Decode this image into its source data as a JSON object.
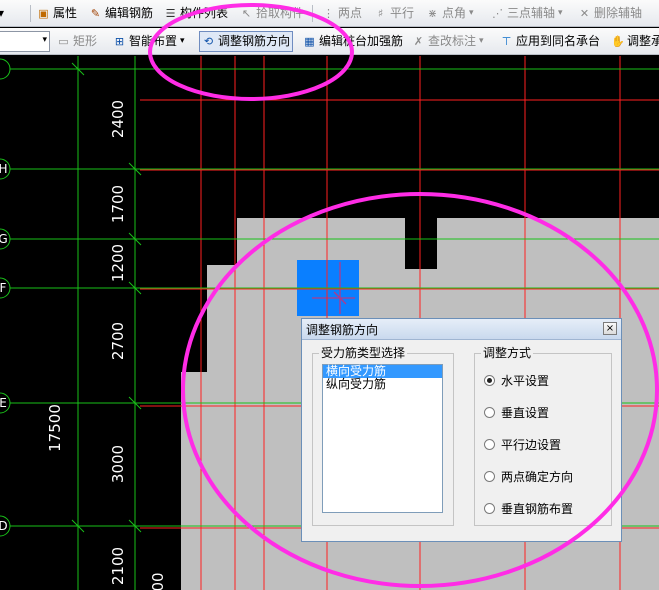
{
  "toolbar_top": {
    "items": [
      {
        "label": "属性",
        "icon": "properties-icon"
      },
      {
        "label": "编辑钢筋",
        "icon": "edit-rebar-icon"
      },
      {
        "label": "构件列表",
        "icon": "component-list-icon"
      },
      {
        "label": "拾取构件",
        "icon": "pick-component-icon"
      },
      {
        "label": "两点",
        "icon": "two-point-icon"
      },
      {
        "label": "平行",
        "icon": "parallel-icon"
      },
      {
        "label": "点角",
        "icon": "point-angle-icon"
      },
      {
        "label": "三点辅轴",
        "icon": "three-point-axis-icon"
      },
      {
        "label": "删除辅轴",
        "icon": "delete-axis-icon"
      }
    ]
  },
  "toolbar_second": {
    "items": [
      {
        "label": "矩形",
        "icon": "rectangle-icon"
      },
      {
        "label": "智能布置",
        "icon": "smart-layout-icon"
      },
      {
        "label": "调整钢筋方向",
        "icon": "adjust-rebar-direction-icon"
      },
      {
        "label": "编辑桩台加强筋",
        "icon": "edit-pile-cap-rebar-icon"
      },
      {
        "label": "查改标注",
        "icon": "check-annotation-icon"
      },
      {
        "label": "应用到同名承台",
        "icon": "apply-same-cap-icon"
      },
      {
        "label": "调整承",
        "icon": "adjust-cap-icon"
      }
    ]
  },
  "canvas": {
    "axis_labels": [
      "H",
      "G",
      "F",
      "E",
      "D"
    ],
    "dimensions": [
      "2400",
      "1700",
      "1200",
      "2700",
      "3000",
      "2100"
    ],
    "total_dimension": "17500",
    "partial_label": "00",
    "colors": {
      "background": "#000000",
      "slab": "#bfbfbf",
      "grid": "#ff2020",
      "axis": "#19c019",
      "selection": "#0a7fff",
      "annotation": "#ff2ce6"
    }
  },
  "dialog": {
    "title": "调整钢筋方向",
    "close_glyph": "×",
    "rebar_group_label": "受力筋类型选择",
    "rebar_types": [
      "横向受力筋",
      "纵向受力筋"
    ],
    "selected_rebar_index": 0,
    "method_group_label": "调整方式",
    "methods": [
      "水平设置",
      "垂直设置",
      "平行边设置",
      "两点确定方向",
      "垂直钢筋布置"
    ],
    "selected_method_index": 0
  }
}
